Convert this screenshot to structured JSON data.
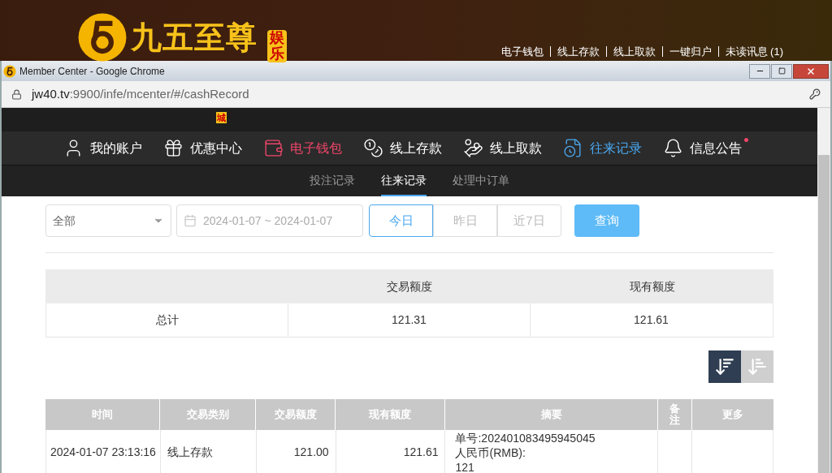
{
  "site_header": {
    "logo_text": "九五至尊",
    "logo_badge": "娱乐",
    "links": [
      "电子钱包",
      "线上存款",
      "线上取款",
      "一键归户",
      "未读讯息 (1)"
    ]
  },
  "browser": {
    "title": "Member Center - Google Chrome",
    "url_host": "jw40.tv",
    "url_rest": ":9900/infe/mcenter/#/cashRecord"
  },
  "site": {
    "logo_badge": "城"
  },
  "nav": [
    {
      "label": "我的账户",
      "kind": "user",
      "selected": false,
      "dot": false,
      "highlight": false
    },
    {
      "label": "优惠中心",
      "kind": "gift",
      "selected": false,
      "dot": false,
      "highlight": false
    },
    {
      "label": "电子钱包",
      "kind": "wallet",
      "selected": false,
      "dot": false,
      "highlight": true
    },
    {
      "label": "线上存款",
      "kind": "deposit",
      "selected": false,
      "dot": false,
      "highlight": false
    },
    {
      "label": "线上取款",
      "kind": "withdraw",
      "selected": false,
      "dot": false,
      "highlight": false
    },
    {
      "label": "往来记录",
      "kind": "record",
      "selected": true,
      "dot": false,
      "highlight": false
    },
    {
      "label": "信息公告",
      "kind": "bell",
      "selected": false,
      "dot": true,
      "highlight": false
    }
  ],
  "subtabs": [
    {
      "label": "投注记录",
      "selected": false
    },
    {
      "label": "往来记录",
      "selected": true
    },
    {
      "label": "处理中订单",
      "selected": false
    }
  ],
  "filter": {
    "type_select": "全部",
    "date_range": "2024-01-07 ~ 2024-01-07",
    "ranges": [
      {
        "label": "今日",
        "selected": true
      },
      {
        "label": "昨日",
        "selected": false
      },
      {
        "label": "近7日",
        "selected": false
      }
    ],
    "query_button": "查询"
  },
  "summary": {
    "columns": [
      "交易额度",
      "现有额度"
    ],
    "row": [
      "总计",
      "121.31",
      "121.61"
    ]
  },
  "sort_buttons": [
    {
      "kind": "desc",
      "selected": true
    },
    {
      "kind": "asc",
      "selected": false
    }
  ],
  "table": {
    "columns": [
      "时间",
      "交易类别",
      "交易额度",
      "现有额度",
      "摘要",
      "备注",
      "更多"
    ],
    "rows": [
      {
        "time": "2024-01-07 23:13:16",
        "type": "线上存款",
        "amount": "121.00",
        "balance": "121.61",
        "summary": [
          "单号:202401083495945045",
          "人民币(RMB):",
          "121"
        ]
      }
    ]
  }
}
